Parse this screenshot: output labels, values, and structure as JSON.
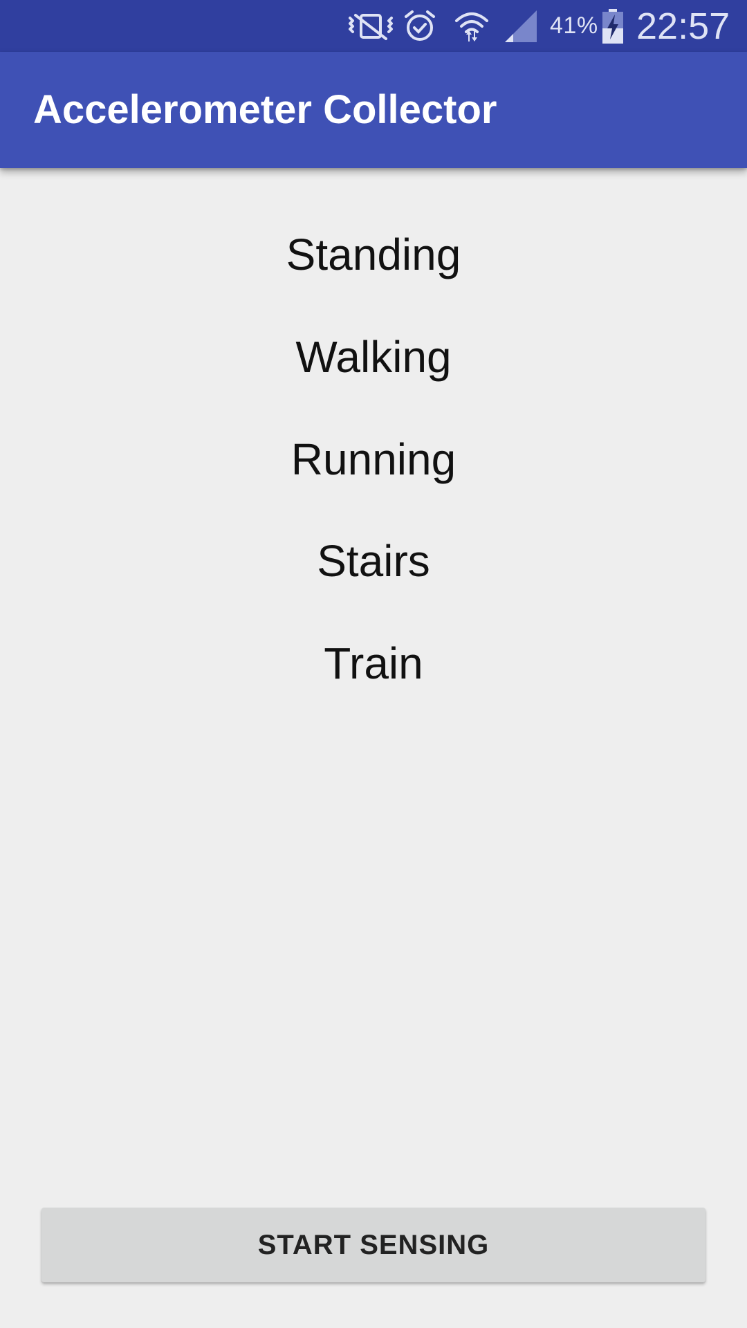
{
  "status_bar": {
    "icons": [
      "vibrate-icon",
      "alarm-icon",
      "wifi-icon",
      "signal-icon",
      "battery-charging-icon"
    ],
    "battery_percent": "41%",
    "time": "22:57",
    "color": "#303f9f"
  },
  "app_bar": {
    "title": "Accelerometer Collector",
    "color": "#3f51b5"
  },
  "activities": [
    {
      "label": "Standing"
    },
    {
      "label": "Walking"
    },
    {
      "label": "Running"
    },
    {
      "label": "Stairs"
    },
    {
      "label": "Train"
    }
  ],
  "start_button": {
    "label": "START SENSING"
  },
  "colors": {
    "background": "#eeeeee",
    "button": "#d6d7d7"
  }
}
